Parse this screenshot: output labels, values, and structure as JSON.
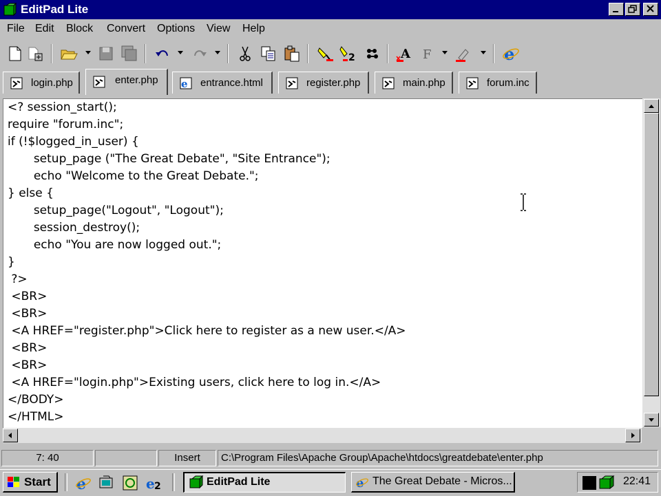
{
  "window": {
    "title": "EditPad Lite",
    "minimize": "_",
    "restore": "❐",
    "close": "✕"
  },
  "menu": [
    "File",
    "Edit",
    "Block",
    "Convert",
    "Options",
    "View",
    "Help"
  ],
  "toolbar": {
    "icons": [
      "new-file-icon",
      "new-window-icon",
      "open-icon",
      "save-icon",
      "save-all-icon",
      "undo-icon",
      "redo-icon",
      "cut-icon",
      "copy-icon",
      "paste-icon",
      "highlight-icon",
      "block-icon",
      "word-wrap-icon",
      "font-icon",
      "format-icon",
      "color-icon",
      "internet-explorer-icon"
    ]
  },
  "tabs": [
    {
      "label": "login.php",
      "icon": "php-file-icon",
      "active": false
    },
    {
      "label": "enter.php",
      "icon": "php-file-icon",
      "active": true
    },
    {
      "label": "entrance.html",
      "icon": "html-file-icon",
      "active": false
    },
    {
      "label": "register.php",
      "icon": "php-file-icon",
      "active": false
    },
    {
      "label": "main.php",
      "icon": "php-file-icon",
      "active": false
    },
    {
      "label": "forum.inc",
      "icon": "php-file-icon",
      "active": false
    }
  ],
  "code": [
    "<? session_start();",
    "require \"forum.inc\";",
    "if (!$logged_in_user) {",
    "       setup_page (\"The Great Debate\", \"Site Entrance\");",
    "       echo \"Welcome to the Great Debate.\";",
    "} else {",
    "       setup_page(\"Logout\", \"Logout\");",
    "       session_destroy();",
    "       echo \"You are now logged out.\";",
    "}",
    " ?>",
    " <BR>",
    " <BR>",
    " <A HREF=\"register.php\">Click here to register as a new user.</A>",
    " <BR>",
    " <BR>",
    " <A HREF=\"login.php\">Existing users, click here to log in.</A>",
    "</BODY>",
    "</HTML>"
  ],
  "status": {
    "position": "7: 40",
    "empty": "",
    "mode": "Insert",
    "path": "C:\\Program Files\\Apache Group\\Apache\\htdocs\\greatdebate\\enter.php"
  },
  "taskbar": {
    "start": "Start",
    "tasks": [
      {
        "label": "EditPad Lite",
        "pressed": true
      },
      {
        "label": "The Great Debate - Micros...",
        "pressed": false
      }
    ],
    "clock": "22:41"
  },
  "colors": {
    "titlebar": "#000080",
    "face": "#c0c0c0",
    "editor_bg": "#ffffff"
  }
}
